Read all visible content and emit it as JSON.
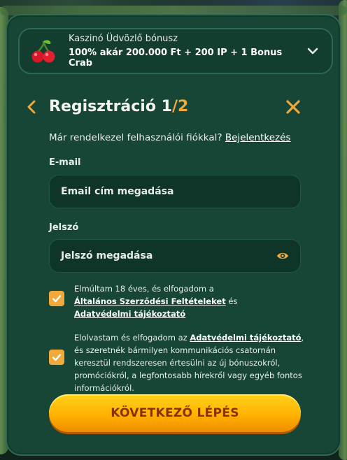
{
  "bonus": {
    "title": "Kaszinó Üdvözlő bónusz",
    "detail": "100% akár 200.000 Ft + 200 IP + 1 Bonus Crab",
    "icon": "cherry-icon",
    "toggle_icon": "chevron-down-icon"
  },
  "header": {
    "title_prefix": "Regisztráció 1",
    "title_suffix": "/2",
    "back_icon": "chevron-left-icon",
    "close_icon": "close-icon"
  },
  "login": {
    "question": "Már rendelkezel felhasználói fiókkal?",
    "link": "Bejelentkezés"
  },
  "email": {
    "label": "E-mail",
    "placeholder": "Email cím megadása"
  },
  "password": {
    "label": "Jelszó",
    "placeholder": "Jelszó megadása",
    "toggle_icon": "eye-icon"
  },
  "consent_age": {
    "checked": true,
    "text_before": "Elmúltam 18 éves, és elfogadom a",
    "link_terms": "Általános Szerződési Feltételeket",
    "text_and": "és",
    "link_privacy": "Adatvédelmi tájékoztató"
  },
  "consent_marketing": {
    "checked": true,
    "text_before": "Elolvastam és elfogadom az",
    "link_privacy": "Adatvédelmi tájékoztató",
    "text_after": ", és szeretnék bármilyen kommunikációs csatornán keresztül rendszeresen értesülni az új bónuszokról, promóciókról, a legfontosabb hírekről vagy egyéb fontos információkról."
  },
  "cta": {
    "label": "KÖVETKEZŐ LÉPÉS"
  },
  "colors": {
    "accent": "#f0a93a",
    "panel": "#174636",
    "cta_top": "#ffd21a",
    "cta_text": "#8a2f00"
  }
}
